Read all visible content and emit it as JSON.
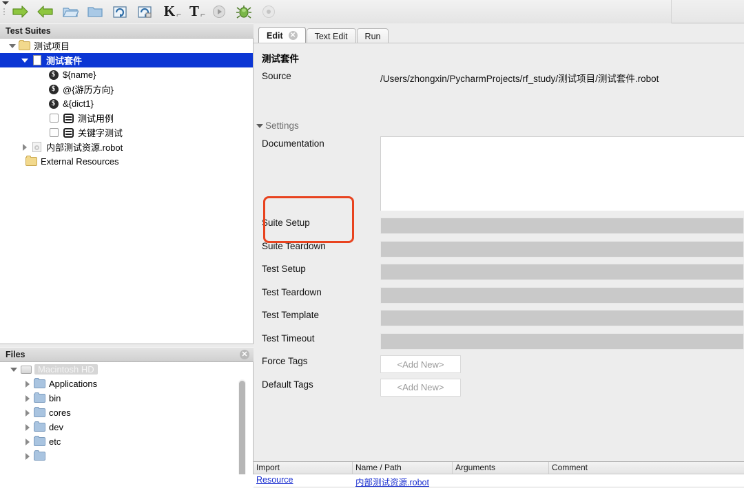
{
  "toolbar": {
    "buttons": [
      {
        "name": "back-arrow",
        "label": "Back"
      },
      {
        "name": "forward-arrow",
        "label": "Forward"
      },
      {
        "name": "open-folder",
        "label": "Open Directory"
      },
      {
        "name": "new-folder",
        "label": "New Project"
      },
      {
        "name": "save",
        "label": "Save"
      },
      {
        "name": "save-all",
        "label": "Save All"
      },
      {
        "name": "new-keyword",
        "label": "K"
      },
      {
        "name": "new-testcase",
        "label": "T"
      },
      {
        "name": "run",
        "label": "Run"
      },
      {
        "name": "debug",
        "label": "Debug"
      },
      {
        "name": "stop",
        "label": "Stop"
      }
    ]
  },
  "suites_panel": {
    "title": "Test Suites",
    "tree": [
      {
        "label": "测试项目",
        "depth": 0,
        "twist": "down",
        "icon": "folder-yellow",
        "selected": false
      },
      {
        "label": "测试套件",
        "depth": 1,
        "twist": "down",
        "icon": "document",
        "selected": true
      },
      {
        "label": "${name}",
        "depth": 2,
        "twist": "none",
        "icon": "variable",
        "selected": false
      },
      {
        "label": "@{游历方向}",
        "depth": 2,
        "twist": "none",
        "icon": "variable",
        "selected": false
      },
      {
        "label": "&{dict1}",
        "depth": 2,
        "twist": "none",
        "icon": "variable",
        "selected": false
      },
      {
        "label": "测试用例",
        "depth": 2,
        "twist": "none",
        "icon": "testcase",
        "selected": false
      },
      {
        "label": "关键字测试",
        "depth": 2,
        "twist": "none",
        "icon": "testcase",
        "selected": false
      },
      {
        "label": "内部测试资源.robot",
        "depth": 1,
        "twist": "right",
        "icon": "resource",
        "selected": false
      },
      {
        "label": "External Resources",
        "depth": 1,
        "twist": "none",
        "icon": "folder-yellow-open",
        "selected": false
      }
    ]
  },
  "files_panel": {
    "title": "Files",
    "close_label": "✕",
    "tree": [
      {
        "label": "Macintosh HD",
        "depth": 0,
        "twist": "down",
        "icon": "harddisk",
        "selected": true
      },
      {
        "label": "Applications",
        "depth": 1,
        "twist": "right",
        "icon": "folder-blue",
        "selected": false
      },
      {
        "label": "bin",
        "depth": 1,
        "twist": "right",
        "icon": "folder-blue",
        "selected": false
      },
      {
        "label": "cores",
        "depth": 1,
        "twist": "right",
        "icon": "folder-blue",
        "selected": false
      },
      {
        "label": "dev",
        "depth": 1,
        "twist": "right",
        "icon": "folder-blue",
        "selected": false
      },
      {
        "label": "etc",
        "depth": 1,
        "twist": "right",
        "icon": "folder-blue",
        "selected": false
      }
    ]
  },
  "editor": {
    "tabs": [
      {
        "label": "Edit",
        "active": true,
        "closable": true,
        "close_label": "✕"
      },
      {
        "label": "Text Edit",
        "active": false,
        "closable": false
      },
      {
        "label": "Run",
        "active": false,
        "closable": false
      }
    ],
    "suite_name": "测试套件",
    "source_label": "Source",
    "source_value": "/Users/zhongxin/PycharmProjects/rf_study/测试项目/测试套件.robot",
    "settings_label": "Settings",
    "settings_expanded": true,
    "fields": [
      {
        "label": "Documentation",
        "control": "textarea",
        "value": ""
      },
      {
        "label": "Suite Setup",
        "control": "grey",
        "value": "",
        "highlighted": true
      },
      {
        "label": "Suite Teardown",
        "control": "grey",
        "value": "",
        "highlighted": true
      },
      {
        "label": "Test Setup",
        "control": "grey",
        "value": ""
      },
      {
        "label": "Test Teardown",
        "control": "grey",
        "value": ""
      },
      {
        "label": "Test Template",
        "control": "grey",
        "value": ""
      },
      {
        "label": "Test Timeout",
        "control": "grey",
        "value": ""
      },
      {
        "label": "Force Tags",
        "control": "addnew",
        "value": "<Add New>"
      },
      {
        "label": "Default Tags",
        "control": "addnew",
        "value": "<Add New>"
      }
    ]
  },
  "imports_table": {
    "columns": [
      "Import",
      "Name / Path",
      "Arguments",
      "Comment"
    ],
    "rows": [
      {
        "import": "Resource",
        "name_path": "内部测试资源.robot",
        "arguments": "",
        "comment": ""
      }
    ]
  },
  "annotation": {
    "color": "#e8431f",
    "targets": [
      "Suite Setup",
      "Suite Teardown"
    ]
  }
}
